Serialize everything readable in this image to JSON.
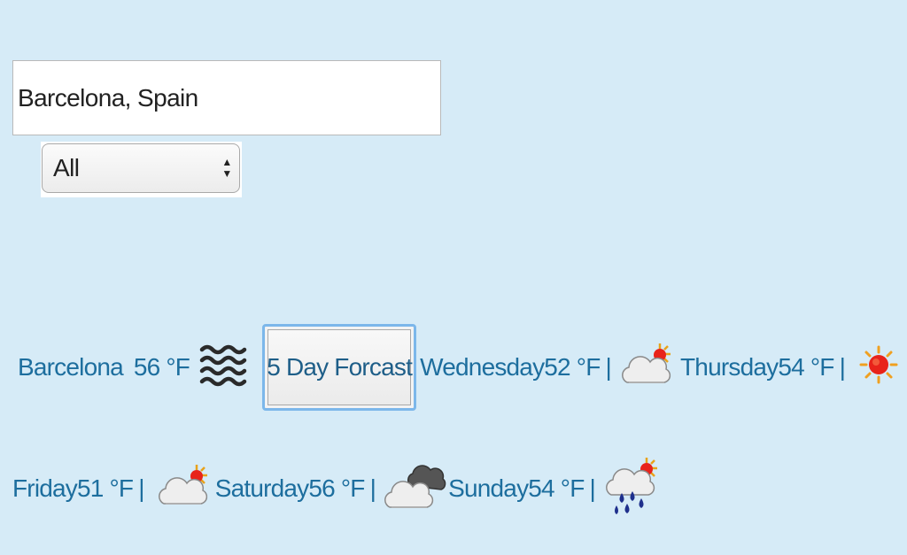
{
  "search": {
    "value": "Barcelona, Spain"
  },
  "filter": {
    "selected": "All",
    "arrow_up": "▲",
    "arrow_down": "▼"
  },
  "current": {
    "city": "Barcelona",
    "temp": "56 °F",
    "icon": "fog-icon"
  },
  "forecast_button": {
    "label": "5 Day Forcast"
  },
  "separator": "|",
  "days": [
    {
      "day": "Wednesday",
      "temp": "52 °F",
      "icon": "partly-cloudy-icon"
    },
    {
      "day": "Thursday",
      "temp": "54 °F",
      "icon": "sunny-icon"
    },
    {
      "day": "Friday",
      "temp": "51 °F",
      "icon": "partly-cloudy-icon"
    },
    {
      "day": "Saturday",
      "temp": "56 °F",
      "icon": "mostly-cloudy-icon"
    },
    {
      "day": "Sunday",
      "temp": "54 °F",
      "icon": "rain-icon"
    }
  ],
  "colors": {
    "background": "#d6ebf7",
    "text": "#1d6e9e",
    "button_focus_ring": "#7cb7ea",
    "sun": "#e8231a"
  }
}
